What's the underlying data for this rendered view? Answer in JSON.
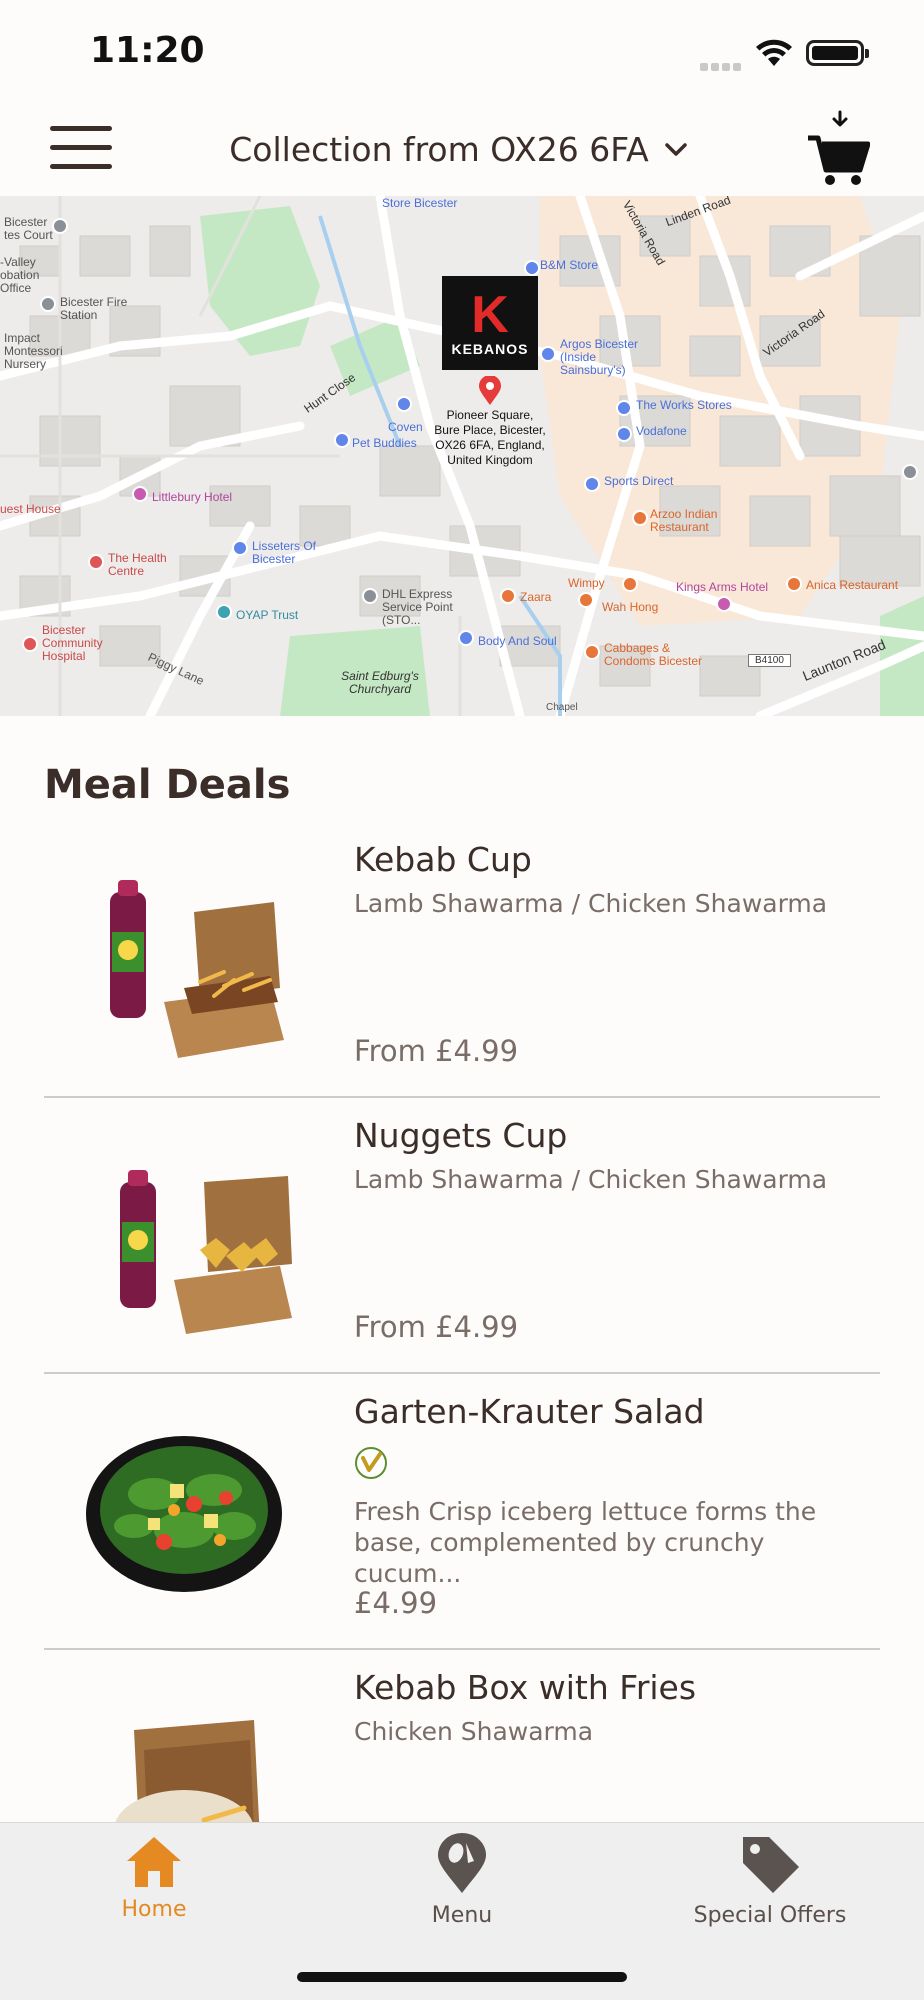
{
  "status_bar": {
    "time": "11:20"
  },
  "header": {
    "location_label": "Collection from OX26 6FA",
    "menu_icon": "hamburger-menu-icon",
    "cart_icon": "cart-icon"
  },
  "map": {
    "brand": "KEBANOS",
    "address_lines": [
      "Pioneer Square,",
      "Bure Place, Bicester,",
      "OX26 6FA, England,",
      "United Kingdom"
    ],
    "places": {
      "store_bicester": "Store Bicester",
      "bm_store": "B&M Store",
      "argos": "Argos Bicester (Inside Sainsbury's)",
      "works": "The Works Stores",
      "vodafone": "Vodafone",
      "sports_direct": "Sports Direct",
      "arzoo": "Arzoo Indian Restaurant",
      "zaara": "Zaara",
      "wimpy": "Wimpy",
      "wah_hong": "Wah Hong",
      "kings_arms": "Kings Arms Hotel",
      "anica": "Anica Restaurant",
      "cabbages": "Cabbages & Condoms Bicester",
      "body_soul": "Body And Soul",
      "dhl": "DHL Express Service Point (STO...",
      "oyap": "OYAP Trust",
      "lisseters": "Lisseters Of Bicester",
      "littlebury": "Littlebury Hotel",
      "health_centre": "The Health Centre",
      "community_hospital": "Bicester Community Hospital",
      "guest_house": "uest House",
      "pet_buddies": "Pet Buddies",
      "coven": "Coven",
      "fire_station": "Bicester Fire Station",
      "montessori": "Impact Montessori Nursery",
      "courts": "Bicester tes Court",
      "valley": "-Valley obation Office",
      "saint_edburgs": "Saint Edburg's Churchyard",
      "hunt_close": "Hunt Close",
      "victoria_road_1": "Victoria Road",
      "victoria_road_2": "Victoria Road",
      "linden_road": "Linden Road",
      "launton_road": "Launton Road",
      "piggy_lane": "Piggy Lane",
      "b4100": "B4100",
      "chapel": "Chapel"
    }
  },
  "section": {
    "title": "Meal Deals"
  },
  "items": [
    {
      "name": "Kebab Cup",
      "description": "Lamb Shawarma / Chicken Shawarma",
      "price": "From £4.99",
      "image": "kebab-cup-with-drink"
    },
    {
      "name": "Nuggets Cup",
      "description": "Lamb Shawarma / Chicken Shawarma",
      "price": "From £4.99",
      "image": "nuggets-cup-with-drink"
    },
    {
      "name": "Garten-Krauter Salad",
      "description": "Fresh Crisp iceberg lettuce forms the base, complemented by crunchy cucum...",
      "price": "£4.99",
      "image": "salad-bowl",
      "badge": "vegetarian-icon"
    },
    {
      "name": "Kebab Box with Fries",
      "description": "Chicken Shawarma",
      "price": "",
      "image": "kebab-box-with-fries"
    }
  ],
  "tabs": [
    {
      "label": "Home",
      "icon": "home-icon",
      "active": true
    },
    {
      "label": "Menu",
      "icon": "location-pin-icon",
      "active": false
    },
    {
      "label": "Special Offers",
      "icon": "tag-icon",
      "active": false
    }
  ],
  "colors": {
    "accent": "#e58923",
    "text": "#3b2d28",
    "muted": "#7a6d67",
    "brand_red": "#e02b28"
  }
}
